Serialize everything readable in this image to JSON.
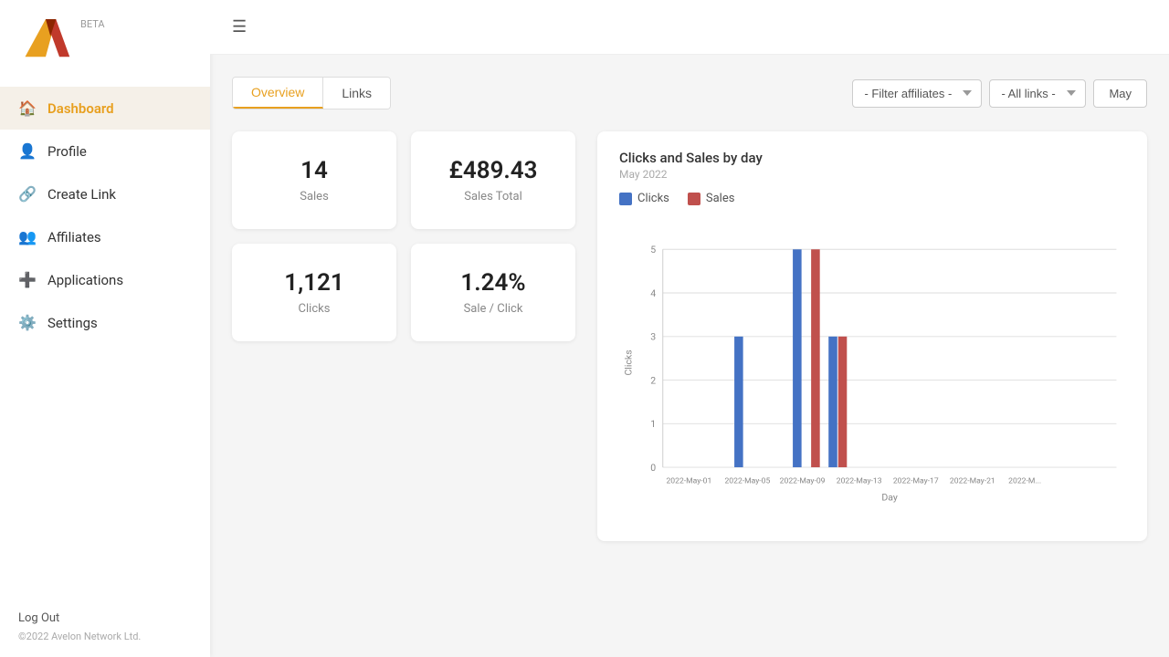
{
  "app": {
    "name": "AV",
    "beta": "BETA",
    "copyright": "©2022 Avelon Network Ltd."
  },
  "sidebar": {
    "items": [
      {
        "id": "dashboard",
        "label": "Dashboard",
        "icon": "🏠",
        "active": true
      },
      {
        "id": "profile",
        "label": "Profile",
        "icon": "👤",
        "active": false
      },
      {
        "id": "create-link",
        "label": "Create Link",
        "icon": "🔗",
        "active": false
      },
      {
        "id": "affiliates",
        "label": "Affiliates",
        "icon": "👥",
        "active": false
      },
      {
        "id": "applications",
        "label": "Applications",
        "icon": "➕",
        "active": false
      },
      {
        "id": "settings",
        "label": "Settings",
        "icon": "⚙️",
        "active": false
      }
    ],
    "logout_label": "Log Out"
  },
  "header": {
    "tabs": [
      {
        "label": "Overview",
        "active": true
      },
      {
        "label": "Links",
        "active": false
      }
    ],
    "filters": {
      "affiliates_placeholder": "- Filter affiliates -",
      "links_placeholder": "- All links -",
      "date_label": "May"
    }
  },
  "stats": [
    {
      "id": "sales",
      "value": "14",
      "label": "Sales"
    },
    {
      "id": "sales-total",
      "value": "£489.43",
      "label": "Sales Total"
    },
    {
      "id": "clicks",
      "value": "1,121",
      "label": "Clicks"
    },
    {
      "id": "sale-click",
      "value": "1.24%",
      "label": "Sale / Click"
    }
  ],
  "chart": {
    "title": "Clicks and Sales by day",
    "subtitle": "May 2022",
    "legend": [
      {
        "id": "clicks",
        "label": "Clicks",
        "color": "#4472C4"
      },
      {
        "id": "sales",
        "label": "Sales",
        "color": "#C0504D"
      }
    ],
    "y_axis_label": "Clicks",
    "x_axis_label": "Day",
    "y_max": 5,
    "x_labels": [
      "2022-May-01",
      "2022-May-05",
      "2022-May-09",
      "2022-May-13",
      "2022-May-17",
      "2022-May-21",
      "2022-M..."
    ],
    "bars": [
      {
        "date": "2022-May-05",
        "clicks": 3,
        "sales": 0
      },
      {
        "date": "2022-May-09",
        "clicks": 5,
        "sales": 0
      },
      {
        "date": "2022-May-11",
        "clicks": 0,
        "sales": 5
      },
      {
        "date": "2022-May-12",
        "clicks": 3,
        "sales": 3
      }
    ],
    "colors": {
      "clicks": "#4472C4",
      "sales": "#C0504D"
    }
  }
}
